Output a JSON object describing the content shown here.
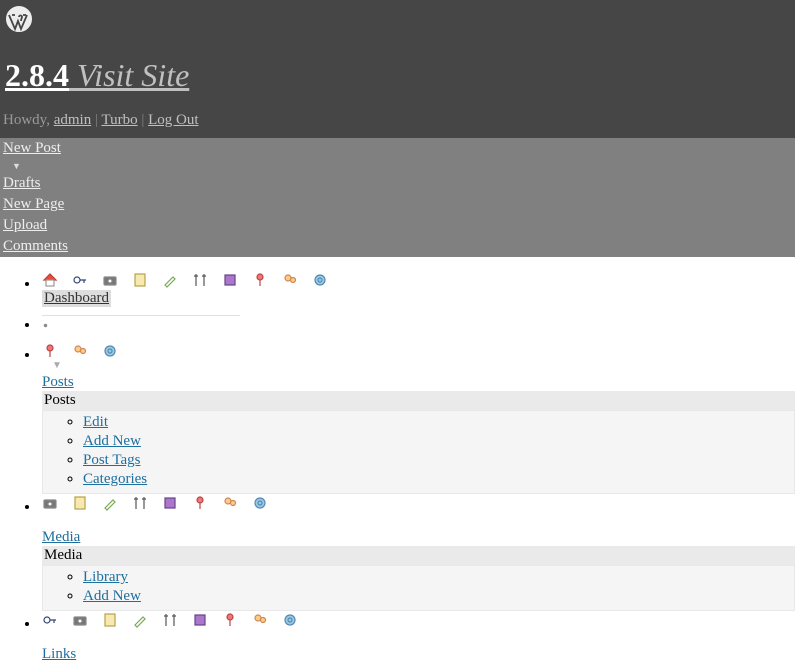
{
  "header": {
    "version": "2.8.4",
    "visit_site": "Visit Site",
    "howdy": "Howdy,",
    "admin": "admin",
    "turbo": "Turbo",
    "logout": "Log Out",
    "sep": " | "
  },
  "quick": {
    "new_post": "New Post",
    "tri": "▼",
    "drafts": "Drafts",
    "new_page": "New Page",
    "upload": "Upload",
    "comments": "Comments"
  },
  "nav": {
    "dashboard": "Dashboard",
    "posts": {
      "label": "Posts",
      "title": "Posts",
      "items": [
        "Edit",
        "Add New",
        "Post Tags",
        "Categories"
      ]
    },
    "media": {
      "label": "Media",
      "title": "Media",
      "items": [
        "Library",
        "Add New"
      ]
    },
    "links": {
      "label": "Links"
    },
    "tri": "▼"
  },
  "icons": {
    "row_full": [
      "home",
      "key",
      "camera",
      "page",
      "brush",
      "tools",
      "plugin",
      "pin",
      "users",
      "gear"
    ],
    "row_three": [
      "pin",
      "users",
      "gear"
    ],
    "row_media": [
      "camera",
      "page",
      "brush",
      "tools",
      "plugin",
      "pin",
      "users",
      "gear"
    ],
    "row_links": [
      "key",
      "camera",
      "page",
      "brush",
      "tools",
      "plugin",
      "pin",
      "users",
      "gear"
    ]
  },
  "colors": {
    "header_bg": "#464646",
    "quick_bg": "#808080",
    "link": "#1e6e9e"
  }
}
